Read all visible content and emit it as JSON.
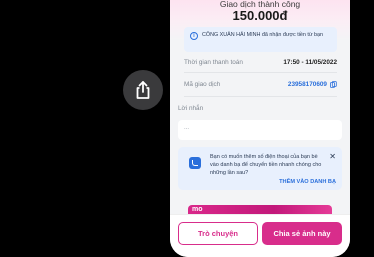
{
  "overlay": {
    "share_icon": "share-icon"
  },
  "receipt": {
    "status": "Giao dịch thành công",
    "amount": "150.000đ",
    "info_message": "CÔNG XUÂN HẢI MINH đã nhận được tiền từ bạn",
    "rows": [
      {
        "label": "Thời gian thanh toán",
        "value": "17:50 - 11/05/2022"
      },
      {
        "label": "Mã giao dịch",
        "value": "23958170609"
      }
    ],
    "note_label": "Lời nhắn",
    "note_placeholder": "...",
    "contact_prompt": "Bạn có muốn thêm số điện thoại của bạn bè vào danh bạ để chuyển tiền nhanh chóng cho những lần sau?",
    "contact_action": "THÊM VÀO DANH BẠ",
    "banner_text": "mo"
  },
  "bottom_bar": {
    "chat_label": "Trò chuyện",
    "share_label": "Chia sẻ ảnh này"
  },
  "colors": {
    "brand": "#d82d8b",
    "link": "#2a6fdb",
    "info_bg": "#e8f0fd"
  }
}
